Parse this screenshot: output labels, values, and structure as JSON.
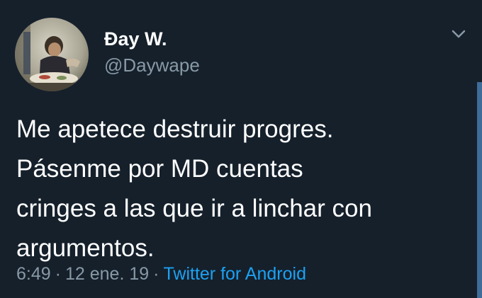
{
  "tweet": {
    "author": {
      "display_name": "Đay W.",
      "handle": "@Daywape"
    },
    "text_lines": [
      "Me apetece destruir progres.",
      "Pásenme por MD cuentas",
      "cringes a las que ir a linchar con",
      "argumentos."
    ],
    "time": "6:49",
    "separator": "·",
    "date": "12 ene. 19",
    "source": "Twitter for Android"
  },
  "colors": {
    "background": "#15202b",
    "primary_text": "#ffffff",
    "secondary_text": "#8899a6",
    "link": "#1da1f2",
    "scrollbar": "#3f6c99"
  },
  "icons": {
    "menu": "chevron-down-icon"
  }
}
